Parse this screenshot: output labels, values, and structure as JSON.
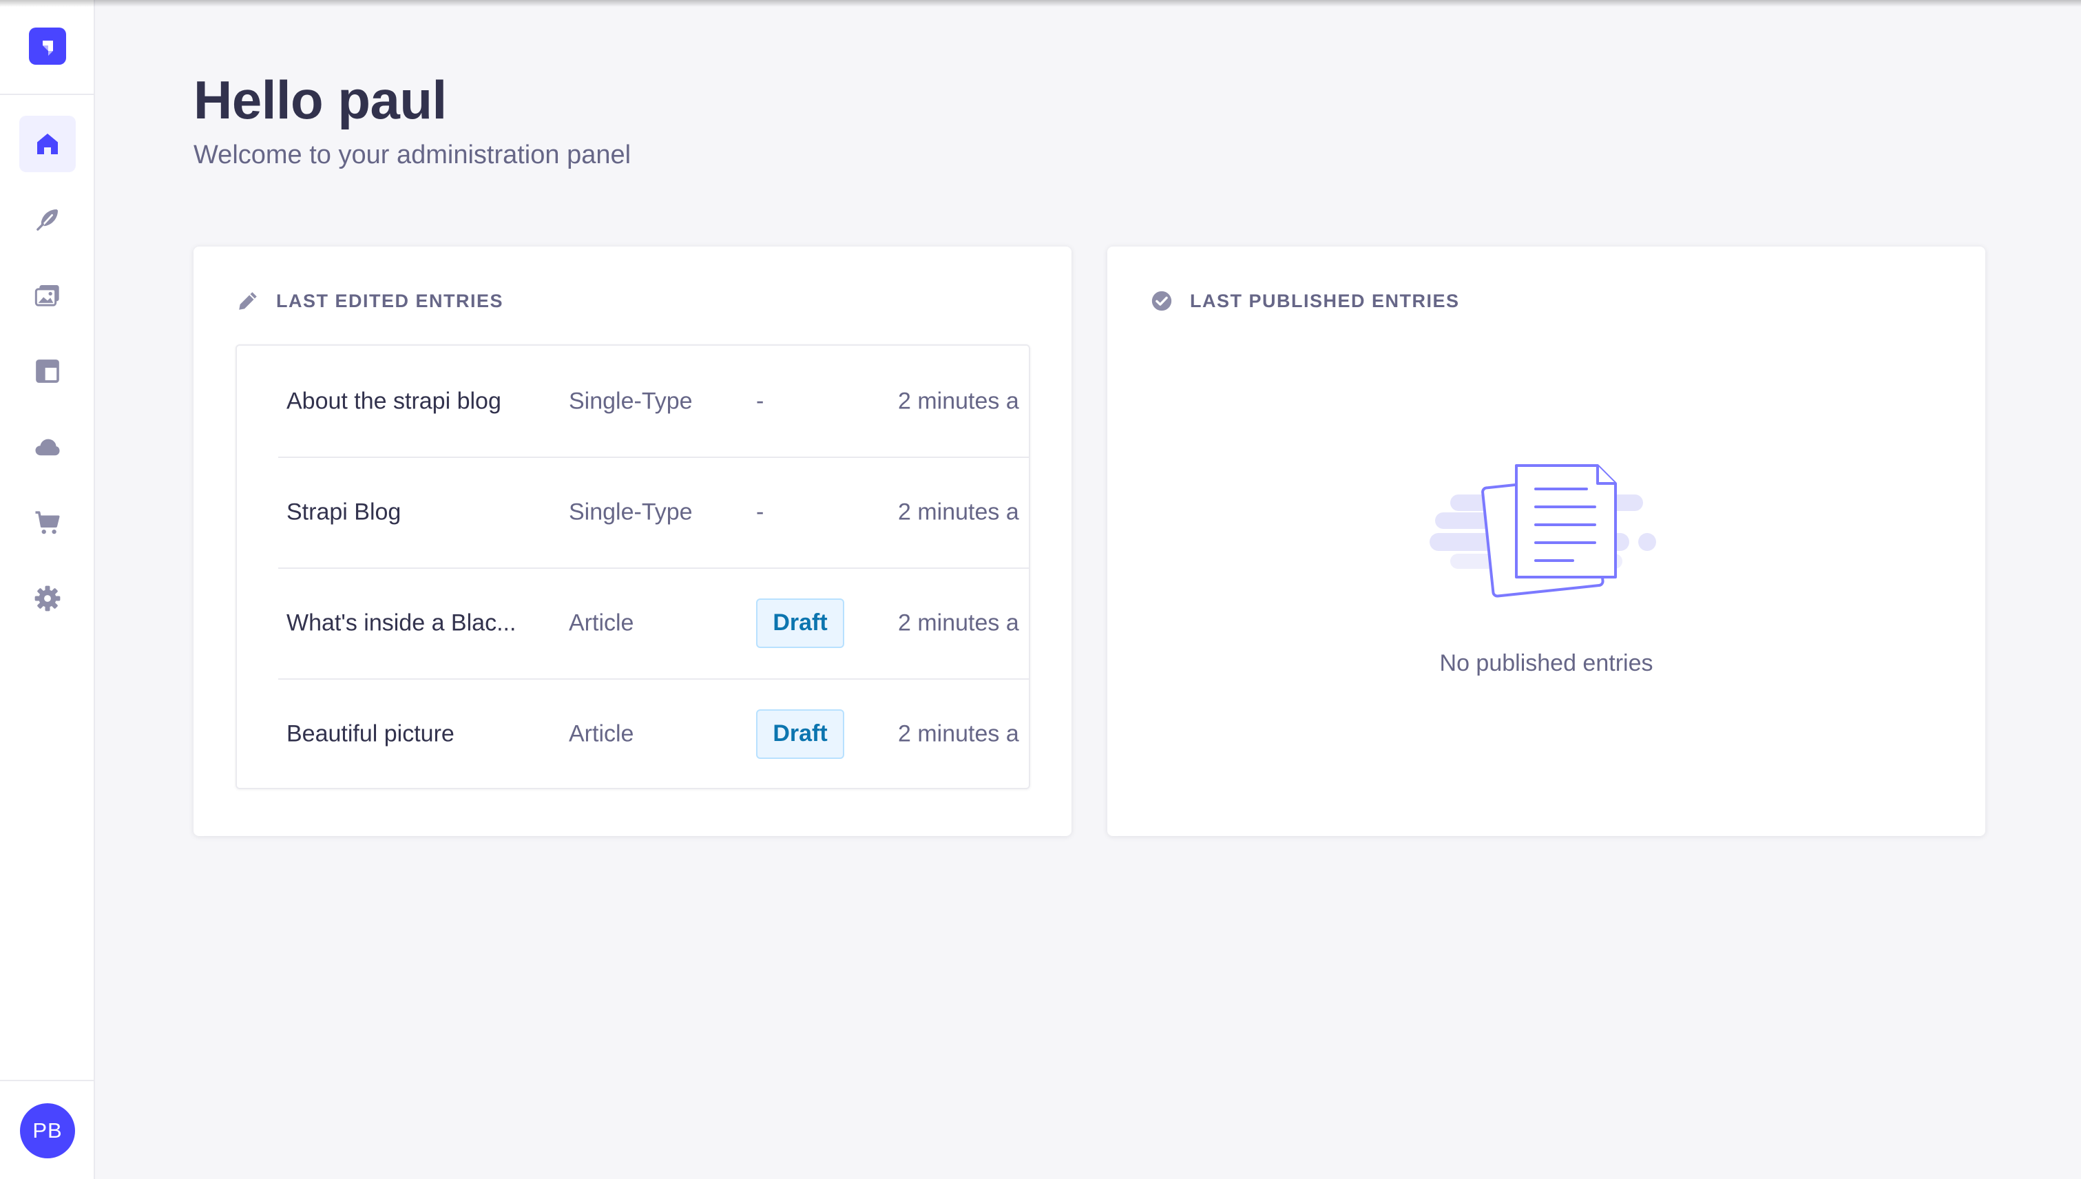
{
  "app": {
    "name": "Strapi",
    "brand_color": "#4945ff",
    "logo_icon": "strapi-logo-icon"
  },
  "sidebar": {
    "items": [
      {
        "id": "home",
        "icon": "home-icon",
        "active": true
      },
      {
        "id": "content-manager",
        "icon": "feather-icon",
        "active": false
      },
      {
        "id": "media-library",
        "icon": "images-icon",
        "active": false
      },
      {
        "id": "content-type-builder",
        "icon": "layout-icon",
        "active": false
      },
      {
        "id": "plugins",
        "icon": "cloud-icon",
        "active": false
      },
      {
        "id": "marketplace",
        "icon": "cart-icon",
        "active": false
      },
      {
        "id": "settings",
        "icon": "gear-icon",
        "active": false
      }
    ],
    "user_initials": "PB"
  },
  "header": {
    "title": "Hello paul",
    "subtitle": "Welcome to your administration panel"
  },
  "last_edited": {
    "title": "LAST EDITED ENTRIES",
    "icon": "pencil-icon",
    "rows": [
      {
        "name": "About the strapi blog",
        "type": "Single-Type",
        "status": "-",
        "time": "2 minutes a"
      },
      {
        "name": "Strapi Blog",
        "type": "Single-Type",
        "status": "-",
        "time": "2 minutes a"
      },
      {
        "name": "What's inside a Blac...",
        "type": "Article",
        "status": "Draft",
        "time": "2 minutes a"
      },
      {
        "name": "Beautiful picture",
        "type": "Article",
        "status": "Draft",
        "time": "2 minutes a"
      }
    ]
  },
  "last_published": {
    "title": "LAST PUBLISHED ENTRIES",
    "icon": "check-circle-icon",
    "empty_text": "No published entries",
    "empty_icon": "documents-illustration-icon"
  },
  "colors": {
    "background": "#f6f6f9",
    "text_primary": "#32324d",
    "text_secondary": "#666687",
    "draft_badge_text": "#0c75af",
    "draft_badge_bg": "#eaf5ff",
    "draft_badge_border": "#b8e1ff"
  }
}
